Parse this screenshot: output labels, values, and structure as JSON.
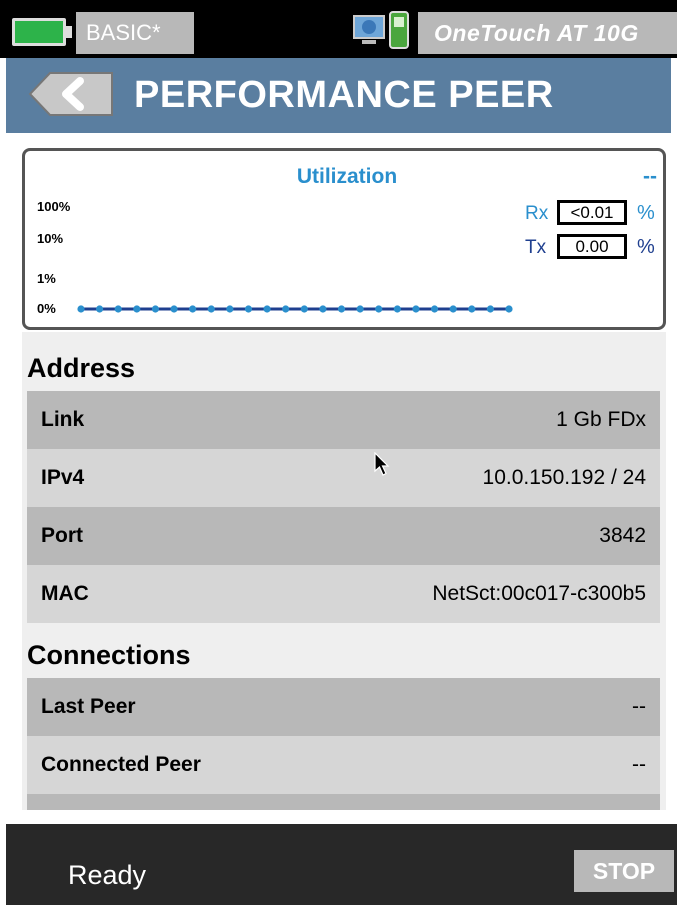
{
  "status_bar": {
    "battery_icon": "battery-full-icon",
    "battery_color": "#2db34a",
    "profile": "BASIC*",
    "device_icon": "tester-connection-icon",
    "device_name": "OneTouch AT 10G"
  },
  "header": {
    "back_icon": "back-arrow-icon",
    "title": "PERFORMANCE PEER",
    "color": "#5a7ea0"
  },
  "utilization": {
    "title": "Utilization",
    "corner_value": "--",
    "y_ticks": [
      "100%",
      "10%",
      "1%",
      "0%"
    ],
    "rx": {
      "label": "Rx",
      "value": "<0.01",
      "unit": "%"
    },
    "tx": {
      "label": "Tx",
      "value": "0.00",
      "unit": "%"
    },
    "history_points": 24,
    "history_values": [
      0,
      0,
      0,
      0,
      0,
      0,
      0,
      0,
      0,
      0,
      0,
      0,
      0,
      0,
      0,
      0,
      0,
      0,
      0,
      0,
      0,
      0,
      0,
      0
    ],
    "accent": "#2a8fcd"
  },
  "address": {
    "heading": "Address",
    "rows": [
      {
        "label": "Link",
        "value": "1 Gb FDx"
      },
      {
        "label": "IPv4",
        "value": "10.0.150.192 / 24"
      },
      {
        "label": "Port",
        "value": "3842"
      },
      {
        "label": "MAC",
        "value": "NetSct:00c017-c300b5"
      }
    ]
  },
  "connections": {
    "heading": "Connections",
    "rows": [
      {
        "label": "Last Peer",
        "value": "--"
      },
      {
        "label": "Connected Peer",
        "value": "--"
      }
    ]
  },
  "footer": {
    "status": "Ready",
    "stop_label": "STOP"
  }
}
